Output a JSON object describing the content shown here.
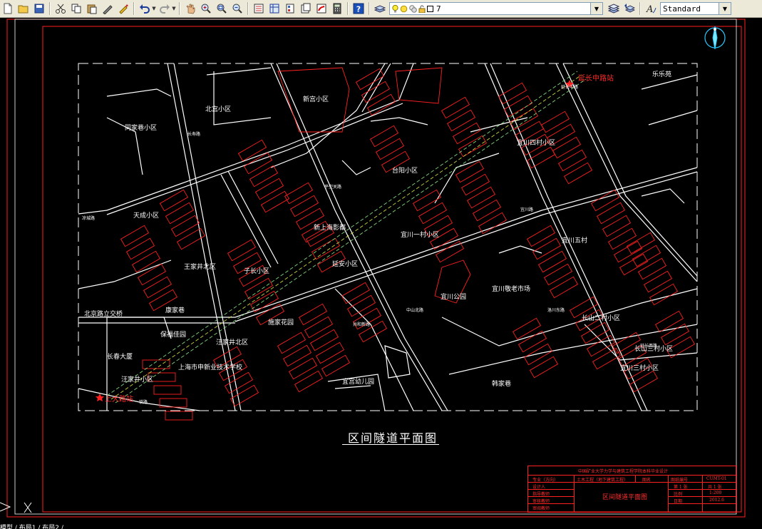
{
  "toolbar": {
    "layer_name": "7",
    "text_style": "Standard",
    "icons": [
      "new-icon",
      "open-icon",
      "save-icon",
      "cut-icon",
      "copy-icon",
      "paste-icon",
      "match-properties-icon",
      "brush-icon",
      "undo-icon",
      "redo-icon",
      "pan-icon",
      "zoom-realtime-icon",
      "zoom-window-icon",
      "zoom-previous-icon",
      "properties-icon",
      "design-center-icon",
      "tool-palettes-icon",
      "sheet-set-icon",
      "markup-icon",
      "calculator-icon",
      "help-icon",
      "layer-manager-icon",
      "layer-previous-icon",
      "text-style-icon"
    ]
  },
  "drawing": {
    "plan_title": "区间隧道平面图",
    "station_labels": {
      "north_station": "延长中路站",
      "south_station": "上大路站"
    },
    "area_labels": [
      "新宫小区",
      "北宫小区",
      "同家巷小区",
      "天成小区",
      "台阳小区",
      "宜川四村小区",
      "宜川一村小区",
      "宜川五村",
      "新上海影都",
      "子长小区",
      "延安小区",
      "宜川公园",
      "宜川敬老市场",
      "施家花园",
      "王家井北区",
      "康家巷",
      "汪家井北区",
      "保福佳园",
      "长春大厦",
      "汪家井小区",
      "上海市申新业技术学校",
      "宜宫幼儿园",
      "宜川三村小区",
      "长山二村小区",
      "长山三村小区",
      "北京路立交桥",
      "乐乐苑",
      "韩家巷"
    ],
    "street_labels": [
      "延长中路",
      "长寿路",
      "平型关路",
      "宜川路",
      "中山北路",
      "共和新路",
      "洛川东路",
      "延长西路",
      "铁路",
      "凉城路"
    ]
  },
  "title_block": {
    "header": "中国矿业大学力学与建筑工程学院本科毕业设计",
    "rows": [
      {
        "left": "专业（方向）",
        "mid": "土木工程（地下建筑工程）",
        "c1": "图名",
        "c2": "图纸编号",
        "c3": "CUMT-01"
      },
      {
        "left": "设计人",
        "mid": "",
        "c1": "",
        "c2": "第 1 张",
        "c3": "共 1 张"
      },
      {
        "left": "指导教师",
        "mid": "区间隧道平面图",
        "c1": "",
        "c2": "比例",
        "c3": "1:200"
      },
      {
        "left": "审核教师",
        "mid": "",
        "c1": "",
        "c2": "日期",
        "c3": "2012.6"
      },
      {
        "left": "审阅教师",
        "mid": "",
        "c1": "",
        "c2": "",
        "c3": ""
      }
    ]
  },
  "command_line": "模型 / 布局1 / 布局2 /",
  "colors": {
    "background": "#000000",
    "roads": "#ffffff",
    "buildings": "#ff2020",
    "tunnel": "#7fd67f",
    "frame": "#ff2020"
  }
}
